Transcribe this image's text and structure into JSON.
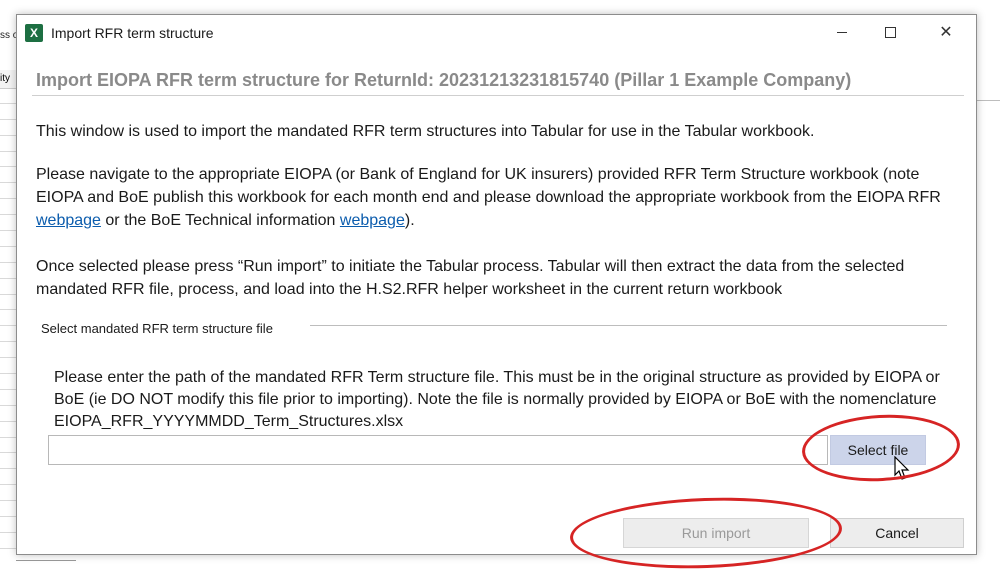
{
  "background": {
    "header_fragment": "ss o",
    "column_header": "ity"
  },
  "window": {
    "title": "Import RFR term structure",
    "app_icon_letter": "X",
    "controls": {
      "minimize_icon": "minimize-icon",
      "maximize_icon": "maximize-icon",
      "close_icon": "close-icon",
      "close_glyph": "✕"
    }
  },
  "dialog": {
    "heading": "Import EIOPA RFR term structure for ReturnId: 20231213231815740 (Pillar 1 Example Company)",
    "intro": "This window is used to import the mandated RFR term structures into Tabular for use in the Tabular workbook.",
    "navigate_part1": "Please navigate to the appropriate EIOPA (or Bank of England for UK insurers) provided RFR Term Structure workbook (note EIOPA and BoE publish this workbook for each month end and please download the appropriate workbook from the EIOPA RFR ",
    "eiopa_link": "webpage",
    "navigate_part2": " or the BoE Technical information ",
    "boe_link": "webpage",
    "navigate_part3": ").",
    "run_instructions": "Once selected please press “Run import” to initiate the Tabular process. Tabular will then extract the data from the selected mandated RFR file, process, and load into the H.S2.RFR helper worksheet in the current return workbook",
    "group_label": "Select mandated RFR term structure file",
    "path_instructions": "Please enter the path of the mandated RFR Term structure file. This must be in the original structure as provided by EIOPA or BoE (ie DO NOT modify this file prior to importing). Note the file is normally provided by EIOPA or BoE with the nomenclature EIOPA_RFR_YYYYMMDD_Term_Structures.xlsx",
    "path_value": "",
    "select_file_label": "Select file",
    "run_import_label": "Run import",
    "cancel_label": "Cancel"
  },
  "colors": {
    "accent_button": "#ccd4ea",
    "annotation_red": "#d62424",
    "link": "#0b5cad",
    "heading_gray": "#8a8a8a"
  }
}
